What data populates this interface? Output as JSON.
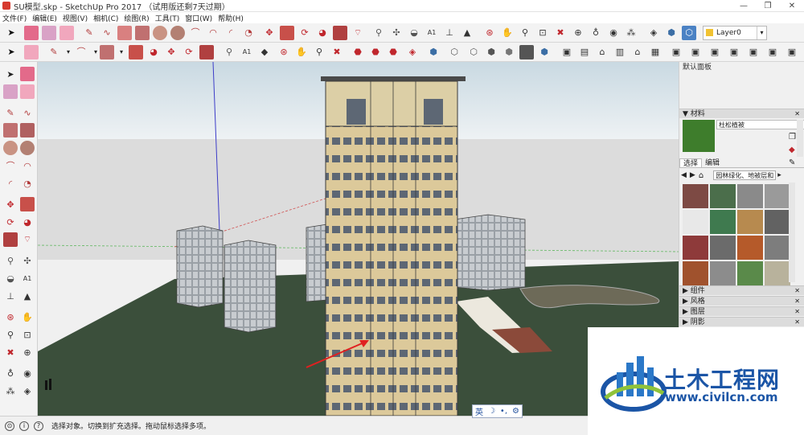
{
  "window": {
    "title": "SU模型.skp - SketchUp Pro 2017 （试用版还剩7天过期）",
    "controls": [
      "—",
      "❐",
      "✕"
    ]
  },
  "menu": [
    "文件(F)",
    "编辑(E)",
    "视图(V)",
    "相机(C)",
    "绘图(R)",
    "工具(T)",
    "窗口(W)",
    "帮助(H)"
  ],
  "layer": {
    "value": "Layer0"
  },
  "tray": {
    "title": "默认面板",
    "materials_header": "▼ 材料",
    "material_name": "杜松植被",
    "tab_select": "选择",
    "tab_edit": "编辑",
    "library": "园林绿化、地被层和",
    "collapsed_sections": [
      "▶ 组件",
      "▶ 风格",
      "▶ 图层",
      "▶ 阴影"
    ]
  },
  "status": {
    "text": "选择对象。切换到扩充选择。拖动鼠标选择多项。"
  },
  "ime": {
    "lang": "英",
    "moon": "☽",
    "dot": "•,",
    "gear": "⚙"
  },
  "watermark": {
    "title": "土木工程网",
    "url": "www.civilcn.com"
  },
  "icons": [
    "select-arrow-icon",
    "eraser-icon",
    "pencil-icon",
    "arc-icon",
    "rectangle-icon",
    "circle-icon",
    "polygon-icon",
    "push-pull-icon",
    "move-icon",
    "rotate-icon",
    "scale-icon",
    "offset-icon",
    "tape-measure-icon",
    "dimension-icon",
    "protractor-icon",
    "text-icon",
    "axes-icon",
    "orbit-icon",
    "pan-icon",
    "zoom-icon",
    "zoom-extents-icon",
    "walk-icon",
    "look-around-icon",
    "section-plane-icon",
    "house-icon",
    "cube-icon"
  ]
}
